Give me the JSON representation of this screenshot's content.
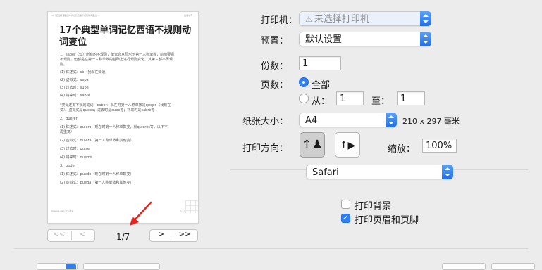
{
  "preview": {
    "header_left": "17个西班牙语典型单词记忆西语不规则动词变位 ...",
    "header_right": "西语学习",
    "title": "17个典型单词记忆西语不规则动词变位",
    "lines": [
      "1、saber（知）所有的不规则，单元音从原形到第一人称单数，前面要保",
      "不规则，但都是在第一人称单数的基础上进行规则变化，其第三都不再规",
      "则。",
      "(1) 陈述式：sé（我现在知道）",
      "(2) 虚拟式：sepa",
      "(3) 过去时：supe",
      "(4) 将来时：sabré",
      "*类似还有不规则动词：caber：现在时第一人称单数是quepo（我现在",
      "变）。虚拟式是quepa；过去时是cupe等；将来时是cabré等",
      "2、querer",
      "(1) 陈述式：quiero（现在时第一人称单数变，就quieres等，以下不",
      "再重复）",
      "(2) 虚拟式：quiera（第一人称单数和其他变）",
      "(3) 过去时：quise",
      "(4) 将来时：querré",
      "3、poder",
      "(1) 陈述式：puedo（现在时第一人称单数变）",
      "(2) 虚拟式：pueda（第一人称单数和其他变）"
    ],
    "footer_left": "hujiang.com 沪江西语",
    "footer_right": "1 / 7"
  },
  "pager": {
    "first": "<<",
    "prev": "<",
    "page": "1/7",
    "next": ">",
    "last": ">>"
  },
  "printer": {
    "label": "打印机：",
    "value": "未选择打印机",
    "icon": "warning-icon"
  },
  "presets": {
    "label": "预置：",
    "value": "默认设置"
  },
  "copies": {
    "label": "份数：",
    "value": "1"
  },
  "pages": {
    "label": "页数：",
    "all_label": "全部",
    "from_label": "从：",
    "from_value": "1",
    "to_label": "至：",
    "to_value": "1"
  },
  "paper": {
    "label": "纸张大小：",
    "value": "A4",
    "dims": "210 x 297 毫米"
  },
  "orientation": {
    "label": "打印方向：",
    "portrait_icon": "portrait-icon",
    "landscape_icon": "landscape-icon"
  },
  "scale": {
    "label": "缩放：",
    "value": "100%"
  },
  "app_menu": {
    "value": "Safari"
  },
  "print_background": {
    "label": "打印背景",
    "checked": false
  },
  "print_headers": {
    "label": "打印页眉和页脚",
    "checked": true
  },
  "colors": {
    "accent": "#2d7ff3",
    "annotation_arrow": "#e8221b"
  }
}
